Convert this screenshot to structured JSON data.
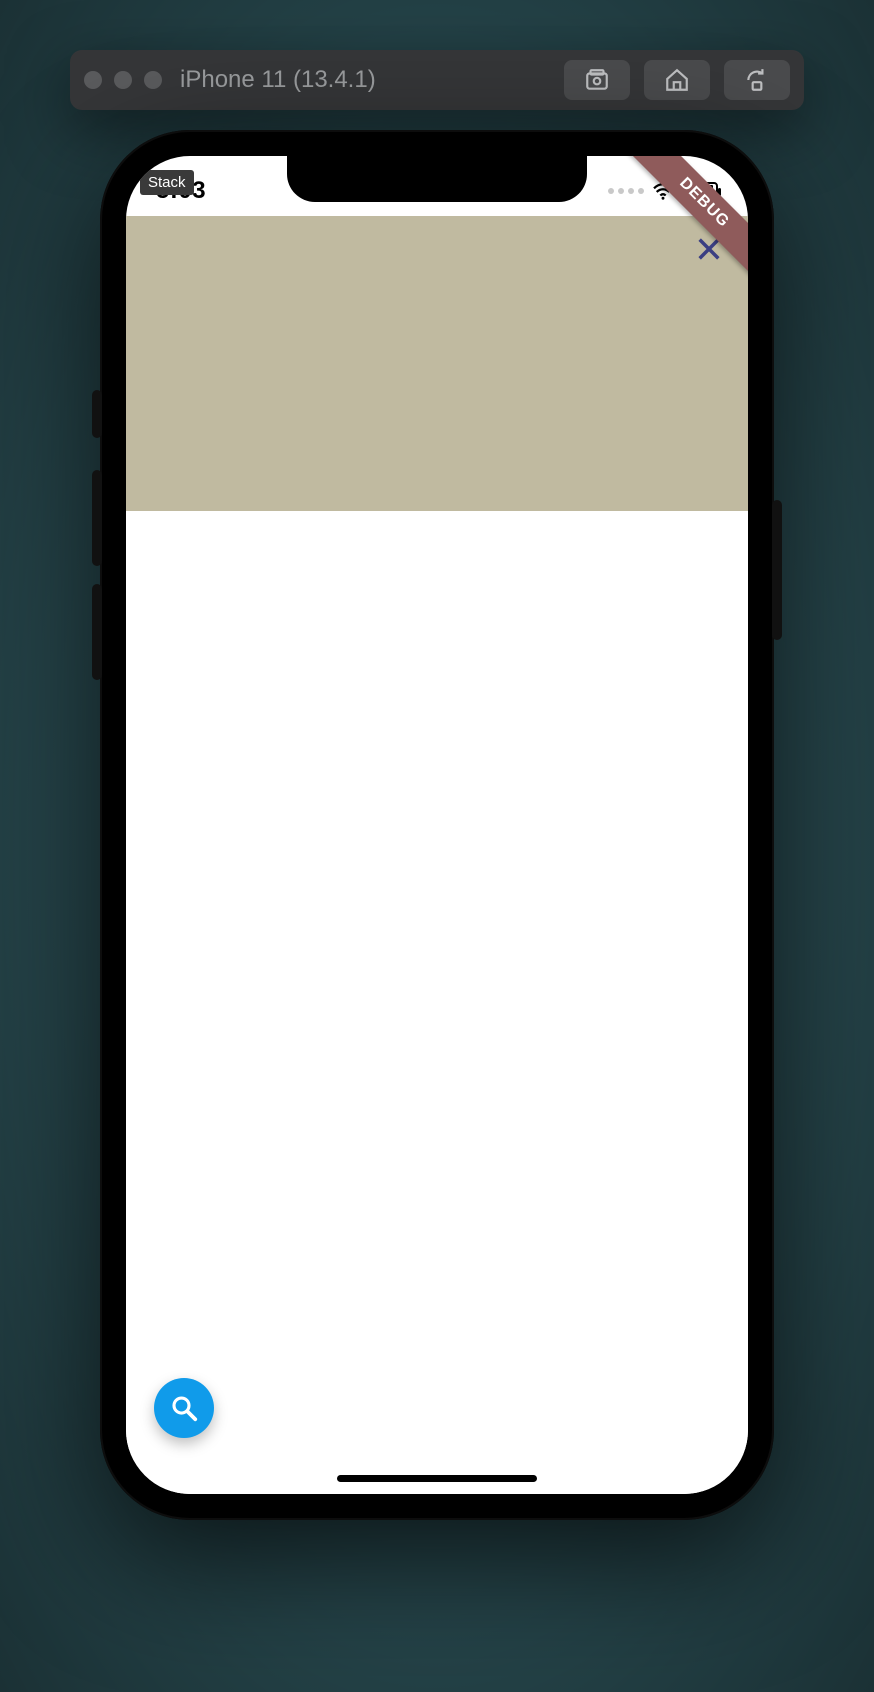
{
  "simulator": {
    "title": "iPhone 11 (13.4.1)",
    "buttons": {
      "screenshot": "screenshot",
      "home": "home",
      "rotate": "rotate"
    }
  },
  "status_bar": {
    "time": "5:03"
  },
  "debug_banner": {
    "label": "DEBUG"
  },
  "tooltip": {
    "label": "Stack"
  },
  "top_panel": {
    "close_label": "Close",
    "bg_color": "#c0baa0"
  },
  "fab": {
    "icon": "search"
  }
}
